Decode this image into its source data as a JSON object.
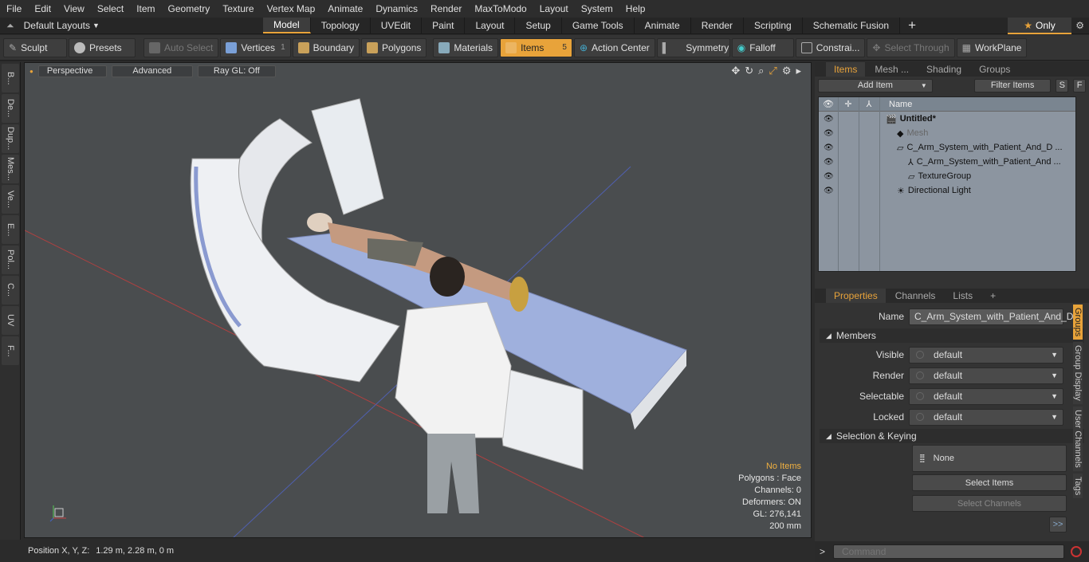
{
  "menu": [
    "File",
    "Edit",
    "View",
    "Select",
    "Item",
    "Geometry",
    "Texture",
    "Vertex Map",
    "Animate",
    "Dynamics",
    "Render",
    "MaxToModo",
    "Layout",
    "System",
    "Help"
  ],
  "layout": {
    "selector": "Default Layouts",
    "tabs": [
      "Model",
      "Topology",
      "UVEdit",
      "Paint",
      "Layout",
      "Setup",
      "Game Tools",
      "Animate",
      "Render",
      "Scripting",
      "Schematic Fusion"
    ],
    "active_tab": "Model",
    "add_tab": "+",
    "only_label": "Only"
  },
  "toolbar": {
    "sculpt": "Sculpt",
    "presets": "Presets",
    "auto_select": "Auto Select",
    "vertices": "Vertices",
    "vertices_count": "1",
    "boundary": "Boundary",
    "polygons": "Polygons",
    "materials": "Materials",
    "items": "Items",
    "items_count": "5",
    "action_center": "Action Center",
    "symmetry": "Symmetry",
    "falloff": "Falloff",
    "constraints": "Constrai...",
    "select_through": "Select Through",
    "workplane": "WorkPlane"
  },
  "left_strip": [
    "B...",
    "De...",
    "Dup...",
    "Mes...",
    "Ve...",
    "E...",
    "Pol...",
    "C...",
    "UV",
    "F..."
  ],
  "viewport": {
    "view": "Perspective",
    "shading": "Advanced",
    "raygl": "Ray GL: Off",
    "info": {
      "selection": "No Items",
      "polygons": "Polygons : Face",
      "channels": "Channels: 0",
      "deformers": "Deformers: ON",
      "gl": "GL: 276,141",
      "scale": "200 mm"
    }
  },
  "status": {
    "position_label": "Position X, Y, Z:",
    "position_value": "1.29 m, 2.28 m, 0 m"
  },
  "items_panel": {
    "tabs": [
      "Items",
      "Mesh ...",
      "Shading",
      "Groups"
    ],
    "active_tab": "Items",
    "add_item": "Add Item",
    "filter": "Filter Items",
    "btn_s": "S",
    "btn_f": "F",
    "column_name": "Name",
    "rows": [
      {
        "label": "Untitled*",
        "bold": true,
        "indent": 0,
        "icon": "scene-icon"
      },
      {
        "label": "Mesh",
        "dim": true,
        "indent": 1,
        "icon": "mesh-icon"
      },
      {
        "label": "C_Arm_System_with_Patient_And_D ...",
        "indent": 1,
        "icon": "group-icon"
      },
      {
        "label": "C_Arm_System_with_Patient_And ...",
        "indent": 2,
        "icon": "locator-icon"
      },
      {
        "label": "TextureGroup",
        "indent": 2,
        "icon": "group-icon"
      },
      {
        "label": "Directional Light",
        "indent": 1,
        "icon": "light-icon"
      }
    ]
  },
  "properties": {
    "tabs": [
      "Properties",
      "Channels",
      "Lists"
    ],
    "active_tab": "Properties",
    "name_label": "Name",
    "name_value": "C_Arm_System_with_Patient_And_Dc",
    "members_section": "Members",
    "fields": [
      {
        "label": "Visible",
        "value": "default"
      },
      {
        "label": "Render",
        "value": "default"
      },
      {
        "label": "Selectable",
        "value": "default"
      },
      {
        "label": "Locked",
        "value": "default"
      }
    ],
    "keying_section": "Selection & Keying",
    "none_label": "None",
    "select_items": "Select Items",
    "select_channels": "Select Channels",
    "more": ">>",
    "side_tabs": [
      "Groups",
      "Group Display",
      "User Channels",
      "Tags"
    ]
  },
  "command": {
    "prompt": ">",
    "placeholder": "Command"
  }
}
